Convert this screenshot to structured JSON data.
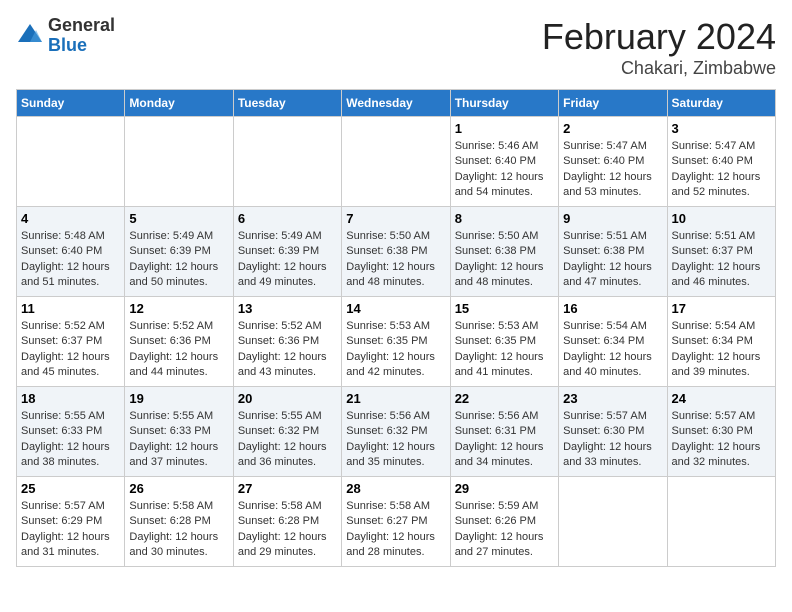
{
  "header": {
    "logo_line1": "General",
    "logo_line2": "Blue",
    "title": "February 2024",
    "subtitle": "Chakari, Zimbabwe"
  },
  "columns": [
    "Sunday",
    "Monday",
    "Tuesday",
    "Wednesday",
    "Thursday",
    "Friday",
    "Saturday"
  ],
  "weeks": [
    [
      {
        "day": "",
        "info": ""
      },
      {
        "day": "",
        "info": ""
      },
      {
        "day": "",
        "info": ""
      },
      {
        "day": "",
        "info": ""
      },
      {
        "day": "1",
        "info": "Sunrise: 5:46 AM\nSunset: 6:40 PM\nDaylight: 12 hours\nand 54 minutes."
      },
      {
        "day": "2",
        "info": "Sunrise: 5:47 AM\nSunset: 6:40 PM\nDaylight: 12 hours\nand 53 minutes."
      },
      {
        "day": "3",
        "info": "Sunrise: 5:47 AM\nSunset: 6:40 PM\nDaylight: 12 hours\nand 52 minutes."
      }
    ],
    [
      {
        "day": "4",
        "info": "Sunrise: 5:48 AM\nSunset: 6:40 PM\nDaylight: 12 hours\nand 51 minutes."
      },
      {
        "day": "5",
        "info": "Sunrise: 5:49 AM\nSunset: 6:39 PM\nDaylight: 12 hours\nand 50 minutes."
      },
      {
        "day": "6",
        "info": "Sunrise: 5:49 AM\nSunset: 6:39 PM\nDaylight: 12 hours\nand 49 minutes."
      },
      {
        "day": "7",
        "info": "Sunrise: 5:50 AM\nSunset: 6:38 PM\nDaylight: 12 hours\nand 48 minutes."
      },
      {
        "day": "8",
        "info": "Sunrise: 5:50 AM\nSunset: 6:38 PM\nDaylight: 12 hours\nand 48 minutes."
      },
      {
        "day": "9",
        "info": "Sunrise: 5:51 AM\nSunset: 6:38 PM\nDaylight: 12 hours\nand 47 minutes."
      },
      {
        "day": "10",
        "info": "Sunrise: 5:51 AM\nSunset: 6:37 PM\nDaylight: 12 hours\nand 46 minutes."
      }
    ],
    [
      {
        "day": "11",
        "info": "Sunrise: 5:52 AM\nSunset: 6:37 PM\nDaylight: 12 hours\nand 45 minutes."
      },
      {
        "day": "12",
        "info": "Sunrise: 5:52 AM\nSunset: 6:36 PM\nDaylight: 12 hours\nand 44 minutes."
      },
      {
        "day": "13",
        "info": "Sunrise: 5:52 AM\nSunset: 6:36 PM\nDaylight: 12 hours\nand 43 minutes."
      },
      {
        "day": "14",
        "info": "Sunrise: 5:53 AM\nSunset: 6:35 PM\nDaylight: 12 hours\nand 42 minutes."
      },
      {
        "day": "15",
        "info": "Sunrise: 5:53 AM\nSunset: 6:35 PM\nDaylight: 12 hours\nand 41 minutes."
      },
      {
        "day": "16",
        "info": "Sunrise: 5:54 AM\nSunset: 6:34 PM\nDaylight: 12 hours\nand 40 minutes."
      },
      {
        "day": "17",
        "info": "Sunrise: 5:54 AM\nSunset: 6:34 PM\nDaylight: 12 hours\nand 39 minutes."
      }
    ],
    [
      {
        "day": "18",
        "info": "Sunrise: 5:55 AM\nSunset: 6:33 PM\nDaylight: 12 hours\nand 38 minutes."
      },
      {
        "day": "19",
        "info": "Sunrise: 5:55 AM\nSunset: 6:33 PM\nDaylight: 12 hours\nand 37 minutes."
      },
      {
        "day": "20",
        "info": "Sunrise: 5:55 AM\nSunset: 6:32 PM\nDaylight: 12 hours\nand 36 minutes."
      },
      {
        "day": "21",
        "info": "Sunrise: 5:56 AM\nSunset: 6:32 PM\nDaylight: 12 hours\nand 35 minutes."
      },
      {
        "day": "22",
        "info": "Sunrise: 5:56 AM\nSunset: 6:31 PM\nDaylight: 12 hours\nand 34 minutes."
      },
      {
        "day": "23",
        "info": "Sunrise: 5:57 AM\nSunset: 6:30 PM\nDaylight: 12 hours\nand 33 minutes."
      },
      {
        "day": "24",
        "info": "Sunrise: 5:57 AM\nSunset: 6:30 PM\nDaylight: 12 hours\nand 32 minutes."
      }
    ],
    [
      {
        "day": "25",
        "info": "Sunrise: 5:57 AM\nSunset: 6:29 PM\nDaylight: 12 hours\nand 31 minutes."
      },
      {
        "day": "26",
        "info": "Sunrise: 5:58 AM\nSunset: 6:28 PM\nDaylight: 12 hours\nand 30 minutes."
      },
      {
        "day": "27",
        "info": "Sunrise: 5:58 AM\nSunset: 6:28 PM\nDaylight: 12 hours\nand 29 minutes."
      },
      {
        "day": "28",
        "info": "Sunrise: 5:58 AM\nSunset: 6:27 PM\nDaylight: 12 hours\nand 28 minutes."
      },
      {
        "day": "29",
        "info": "Sunrise: 5:59 AM\nSunset: 6:26 PM\nDaylight: 12 hours\nand 27 minutes."
      },
      {
        "day": "",
        "info": ""
      },
      {
        "day": "",
        "info": ""
      }
    ]
  ]
}
